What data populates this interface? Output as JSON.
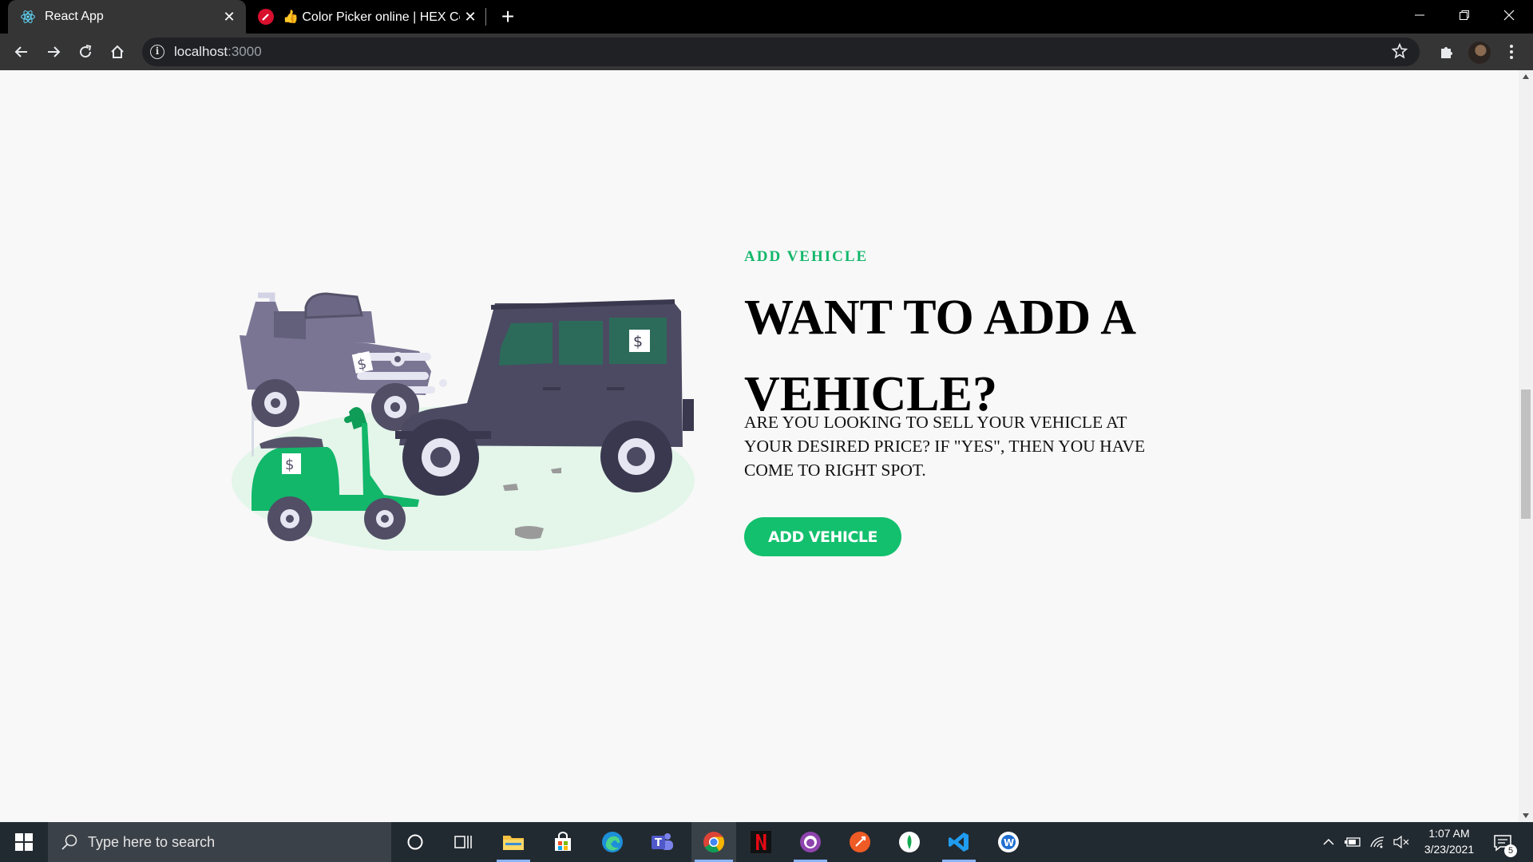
{
  "browser": {
    "tabs": [
      {
        "title": "React App",
        "active": true,
        "icon": "react-icon"
      },
      {
        "title": "👍 Color Picker online | HEX Colo",
        "active": false,
        "icon": "color-picker-icon"
      }
    ],
    "url_host": "localhost",
    "url_port": ":3000"
  },
  "page": {
    "eyebrow": "ADD VEHICLE",
    "headline": "WANT TO ADD A VEHICLE?",
    "subtext": "ARE YOU LOOKING TO SELL YOUR VEHICLE AT YOUR DESIRED PRICE? IF \"YES\", THEN YOU HAVE COME TO RIGHT SPOT.",
    "cta_label": "ADD VEHICLE",
    "accent_color": "#12b76a",
    "price_tag": "$"
  },
  "taskbar": {
    "search_placeholder": "Type here to search",
    "apps": [
      "cortana-icon",
      "task-view-icon",
      "file-explorer-icon",
      "store-icon",
      "edge-icon",
      "teams-icon",
      "chrome-icon",
      "netflix-icon",
      "github-desktop-icon",
      "postman-icon",
      "mongodb-compass-icon",
      "vscode-icon",
      "wps-icon"
    ],
    "time": "1:07 AM",
    "date": "3/23/2021",
    "notification_count": "5"
  }
}
